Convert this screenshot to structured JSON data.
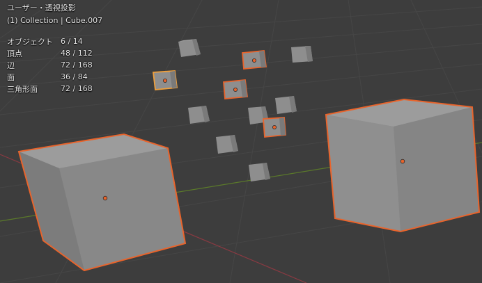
{
  "viewport": {
    "view_mode": "ユーザー・透視投影",
    "collection_info": "(1) Collection | Cube.007"
  },
  "stats": [
    {
      "name": "オブジェクト",
      "value": "6 / 14"
    },
    {
      "name": "頂点",
      "value": "48 / 112"
    },
    {
      "name": "辺",
      "value": "72 / 168"
    },
    {
      "name": "面",
      "value": "36 / 84"
    },
    {
      "name": "三角形面",
      "value": "72 / 168"
    }
  ],
  "colors": {
    "background": "#3d3d3d",
    "grid": "#474747",
    "x_axis": "#8a3a42",
    "y_axis": "#5b7a2a",
    "selected_outline": "#e8642c",
    "active_outline": "#f0a03c",
    "origin_dot": "#e8642c",
    "cube_front": "#8a8a8a",
    "cube_side": "#7a7a7a",
    "cube_top": "#9d9d9d"
  }
}
